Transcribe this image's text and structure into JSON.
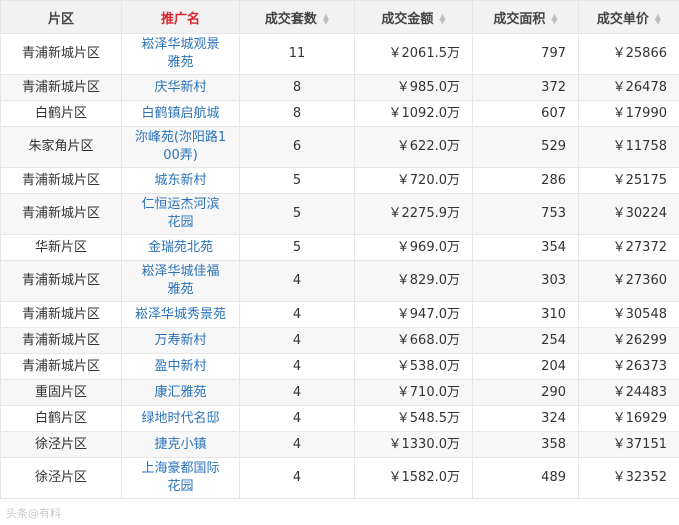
{
  "headers": [
    "片区",
    "推广名",
    "成交套数",
    "成交金额",
    "成交面积",
    "成交单价"
  ],
  "active_header_color": "#d9262c",
  "link_color": "#2a73b8",
  "rows": [
    {
      "district": "青浦新城片区",
      "name": "崧泽华城观景雅苑",
      "units": "11",
      "amount": "￥2061.5万",
      "area": "797",
      "price": "￥25866"
    },
    {
      "district": "青浦新城片区",
      "name": "庆华新村",
      "units": "8",
      "amount": "￥985.0万",
      "area": "372",
      "price": "￥26478"
    },
    {
      "district": "白鹤片区",
      "name": "白鹤镇启航城",
      "units": "8",
      "amount": "￥1092.0万",
      "area": "607",
      "price": "￥17990"
    },
    {
      "district": "朱家角片区",
      "name": "沵峰苑(沵阳路100弄)",
      "units": "6",
      "amount": "￥622.0万",
      "area": "529",
      "price": "￥11758"
    },
    {
      "district": "青浦新城片区",
      "name": "城东新村",
      "units": "5",
      "amount": "￥720.0万",
      "area": "286",
      "price": "￥25175"
    },
    {
      "district": "青浦新城片区",
      "name": "仁恒运杰河滨花园",
      "units": "5",
      "amount": "￥2275.9万",
      "area": "753",
      "price": "￥30224"
    },
    {
      "district": "华新片区",
      "name": "金瑞苑北苑",
      "units": "5",
      "amount": "￥969.0万",
      "area": "354",
      "price": "￥27372"
    },
    {
      "district": "青浦新城片区",
      "name": "崧泽华城佳福雅苑",
      "units": "4",
      "amount": "￥829.0万",
      "area": "303",
      "price": "￥27360"
    },
    {
      "district": "青浦新城片区",
      "name": "崧泽华城秀景苑",
      "units": "4",
      "amount": "￥947.0万",
      "area": "310",
      "price": "￥30548"
    },
    {
      "district": "青浦新城片区",
      "name": "万寿新村",
      "units": "4",
      "amount": "￥668.0万",
      "area": "254",
      "price": "￥26299"
    },
    {
      "district": "青浦新城片区",
      "name": "盈中新村",
      "units": "4",
      "amount": "￥538.0万",
      "area": "204",
      "price": "￥26373"
    },
    {
      "district": "重固片区",
      "name": "康汇雅苑",
      "units": "4",
      "amount": "￥710.0万",
      "area": "290",
      "price": "￥24483"
    },
    {
      "district": "白鹤片区",
      "name": "绿地时代名邸",
      "units": "4",
      "amount": "￥548.5万",
      "area": "324",
      "price": "￥16929"
    },
    {
      "district": "徐泾片区",
      "name": "捷克小镇",
      "units": "4",
      "amount": "￥1330.0万",
      "area": "358",
      "price": "￥37151"
    },
    {
      "district": "徐泾片区",
      "name": "上海豪都国际花园",
      "units": "4",
      "amount": "￥1582.0万",
      "area": "489",
      "price": "￥32352"
    }
  ],
  "watermark": "头条@有料"
}
